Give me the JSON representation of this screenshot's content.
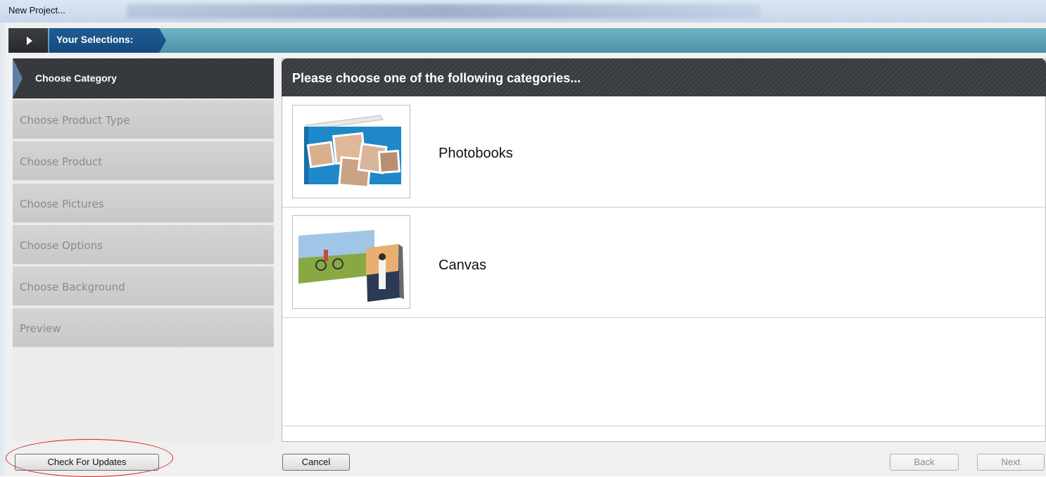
{
  "window": {
    "title": "New Project..."
  },
  "breadcrumb": {
    "label": "Your Selections:"
  },
  "sidebar": {
    "steps": [
      {
        "label": "Choose Category",
        "active": true
      },
      {
        "label": "Choose Product Type",
        "active": false
      },
      {
        "label": "Choose Product",
        "active": false
      },
      {
        "label": "Choose Pictures",
        "active": false
      },
      {
        "label": "Choose Options",
        "active": false
      },
      {
        "label": "Choose Background",
        "active": false
      },
      {
        "label": "Preview",
        "active": false
      }
    ],
    "check_updates_label": "Check For Updates"
  },
  "main": {
    "header": "Please choose one of the following categories...",
    "categories": [
      {
        "label": "Photobooks",
        "icon": "photobook-thumbnail"
      },
      {
        "label": "Canvas",
        "icon": "canvas-thumbnail"
      }
    ]
  },
  "footer": {
    "cancel_label": "Cancel",
    "back_label": "Back",
    "next_label": "Next"
  },
  "colors": {
    "breadcrumb_bar": "#4a93a8",
    "breadcrumb_label": "#1f5c93",
    "header_dark": "#3a3d42",
    "annotation_red": "#d62020"
  }
}
